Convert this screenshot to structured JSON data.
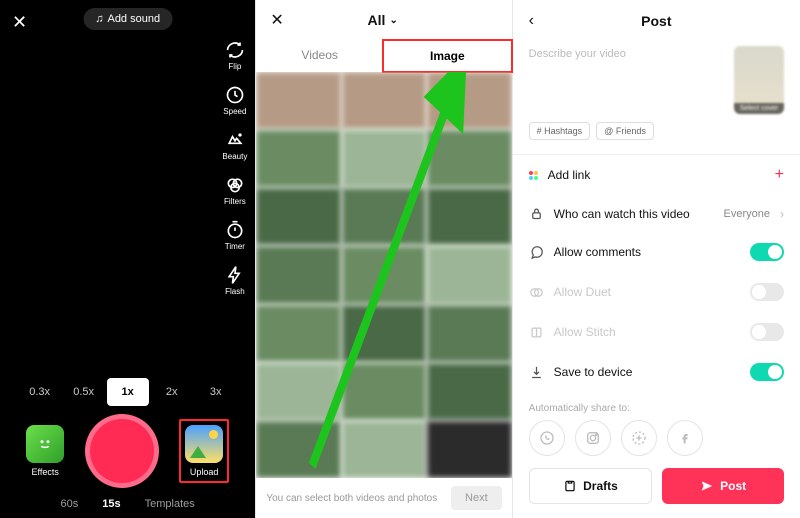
{
  "camera": {
    "add_sound": "Add sound",
    "tools": {
      "flip": "Flip",
      "speed": "Speed",
      "beauty": "Beauty",
      "filters": "Filters",
      "timer": "Timer",
      "flash": "Flash"
    },
    "zoom": [
      "0.3x",
      "0.5x",
      "1x",
      "2x",
      "3x"
    ],
    "zoom_selected": "1x",
    "effects_label": "Effects",
    "upload_label": "Upload",
    "modes": [
      "60s",
      "15s",
      "Templates"
    ],
    "mode_selected": "15s"
  },
  "gallery": {
    "title": "All",
    "tabs": {
      "videos": "Videos",
      "image": "Image"
    },
    "footer_hint": "You can select both videos and photos",
    "next_label": "Next"
  },
  "post": {
    "title": "Post",
    "describe_placeholder": "Describe your video",
    "cover_label": "Select cover",
    "chips": {
      "hashtags": "# Hashtags",
      "friends": "@ Friends"
    },
    "options": {
      "add_link": "Add link",
      "privacy": "Who can watch this video",
      "privacy_value": "Everyone",
      "comments": "Allow comments",
      "duet": "Allow Duet",
      "stitch": "Allow Stitch",
      "save": "Save to device"
    },
    "auto_share_label": "Automatically share to:",
    "drafts_label": "Drafts",
    "post_label": "Post"
  }
}
